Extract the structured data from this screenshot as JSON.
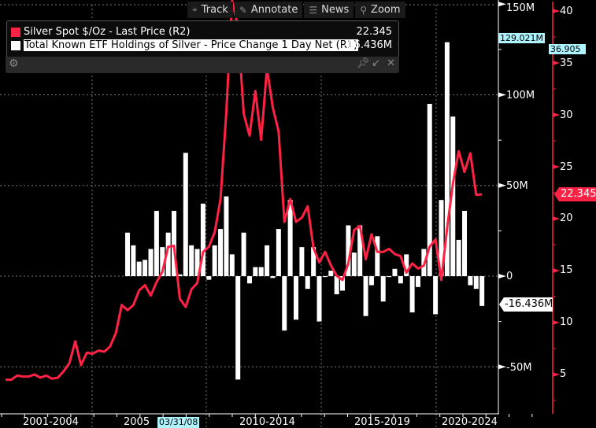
{
  "toolbar": {
    "track": "Track",
    "annotate": "Annotate",
    "news": "News",
    "zoom": "Zoom"
  },
  "legend": {
    "series": [
      {
        "label": "Silver Spot  $/Oz - Last Price (R2)",
        "value": "22.345",
        "color": "#ff2244"
      },
      {
        "label": "Total Known ETF Holdings of Silver - Price Change 1 Day Net (R1)",
        "value": "-16.436M",
        "color": "#ffffff"
      }
    ]
  },
  "markers": {
    "r1_high": "129.021M",
    "r2_high": "36.905",
    "r2_last": "22.345",
    "r1_last": "-16.436M",
    "date_cursor": "03/31/08"
  },
  "chart_data": {
    "type": "bar+line",
    "frequency": "quarterly",
    "x_start": "2001",
    "x_tick_labels": [
      "2001-2004",
      "2005",
      "2010-2014",
      "2015-2019",
      "2020-2024"
    ],
    "left_axis": {
      "name": "R1",
      "ticks": [
        "150M",
        "100M",
        "50M",
        "0",
        "-50M"
      ],
      "range": [
        -75,
        155
      ],
      "unit": "M"
    },
    "right_axis": {
      "name": "R2",
      "ticks": [
        "40",
        "35",
        "30",
        "25",
        "20",
        "15",
        "10",
        "5"
      ],
      "range": [
        0.5,
        41
      ]
    },
    "grid": true,
    "legend_position": "top-left",
    "series": [
      {
        "name": "Silver Spot $/Oz - Last Price (R2)",
        "type": "line",
        "axis": "right",
        "start_index": 0,
        "values": [
          4.5,
          4.5,
          4.9,
          4.8,
          4.8,
          5.0,
          4.7,
          4.9,
          4.6,
          4.7,
          5.3,
          6.1,
          8.2,
          5.9,
          7.1,
          7.0,
          7.3,
          7.2,
          7.7,
          9.0,
          11.7,
          11.2,
          11.7,
          13.1,
          13.6,
          12.6,
          13.9,
          14.9,
          17.3,
          17.4,
          12.3,
          11.5,
          13.2,
          13.8,
          16.8,
          17.3,
          18.7,
          21.9,
          30.2,
          41.0,
          38.5,
          30.1,
          28.0,
          32.3,
          27.6,
          34.5,
          30.7,
          28.4,
          19.7,
          21.9,
          19.7,
          20.1,
          21.2,
          17.2,
          15.8,
          16.8,
          15.5,
          14.5,
          14.1,
          15.7,
          18.9,
          19.3,
          16.1,
          18.5,
          16.8,
          16.8,
          17.1,
          16.6,
          16.4,
          14.8,
          15.7,
          15.2,
          15.5,
          17.3,
          18.0,
          14.1,
          19.1,
          23.4,
          26.5,
          24.5,
          26.3,
          22.3,
          22.345
        ]
      },
      {
        "name": "Total Known ETF Holdings of Silver - Price Change 1 Day Net (R1)",
        "type": "bar",
        "axis": "left",
        "start_index": 21,
        "values": [
          24,
          17,
          8,
          9,
          15,
          36,
          16,
          24,
          36,
          1,
          68,
          17,
          15,
          40,
          -2,
          17,
          26,
          44,
          12,
          -57,
          24,
          -4,
          5,
          5,
          17,
          -1,
          26,
          -30,
          42,
          -24,
          16,
          -7,
          16,
          -25,
          -0.5,
          3,
          -10,
          -8,
          28,
          13,
          28,
          -22,
          -5,
          22,
          -14,
          -0.5,
          4,
          -4,
          12,
          -20,
          -6,
          15,
          95,
          -21,
          42,
          129,
          88,
          20,
          36,
          -5,
          -7,
          -16.436
        ]
      }
    ]
  }
}
